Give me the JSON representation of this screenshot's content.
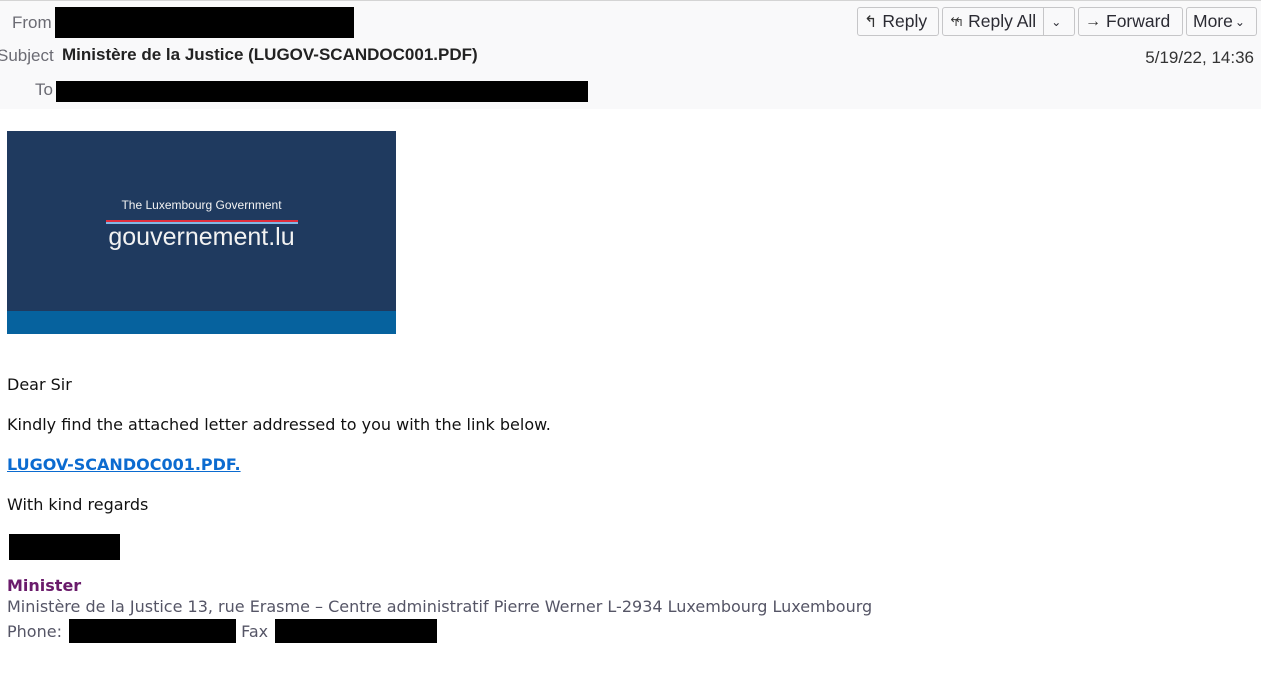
{
  "header": {
    "from_label": "From",
    "subject_label": "Subject",
    "to_label": "To",
    "subject": "Ministère de la Justice (LUGOV-SCANDOC001.PDF)",
    "date": "5/19/22, 14:36",
    "from_value": "[redacted]",
    "to_value": "[redacted]"
  },
  "toolbar": {
    "reply": "Reply",
    "reply_all": "Reply All",
    "forward": "Forward",
    "more": "More",
    "icons": {
      "reply": "↰",
      "reply_all": "↰↰",
      "forward": "→",
      "dropdown": "⌄"
    }
  },
  "banner": {
    "tagline": "The Luxembourg Government",
    "site": "gouvernement.lu",
    "colors": {
      "background": "#1f3a5f",
      "strip": "#06629e",
      "red": "#e02d3c",
      "lightblue": "#7fb8e6"
    }
  },
  "body": {
    "greeting": "Dear Sir",
    "line1": "Kindly find the attached letter addressed to you with the link below.",
    "link_text": "LUGOV-SCANDOC001.PDF.",
    "closing": "With kind regards"
  },
  "signature": {
    "title": "Minister",
    "address": "Ministère de la Justice 13, rue Erasme – Centre administratif Pierre Werner L-2934 Luxembourg Luxembourg",
    "phone_label": "Phone:",
    "fax_label": "Fax"
  }
}
